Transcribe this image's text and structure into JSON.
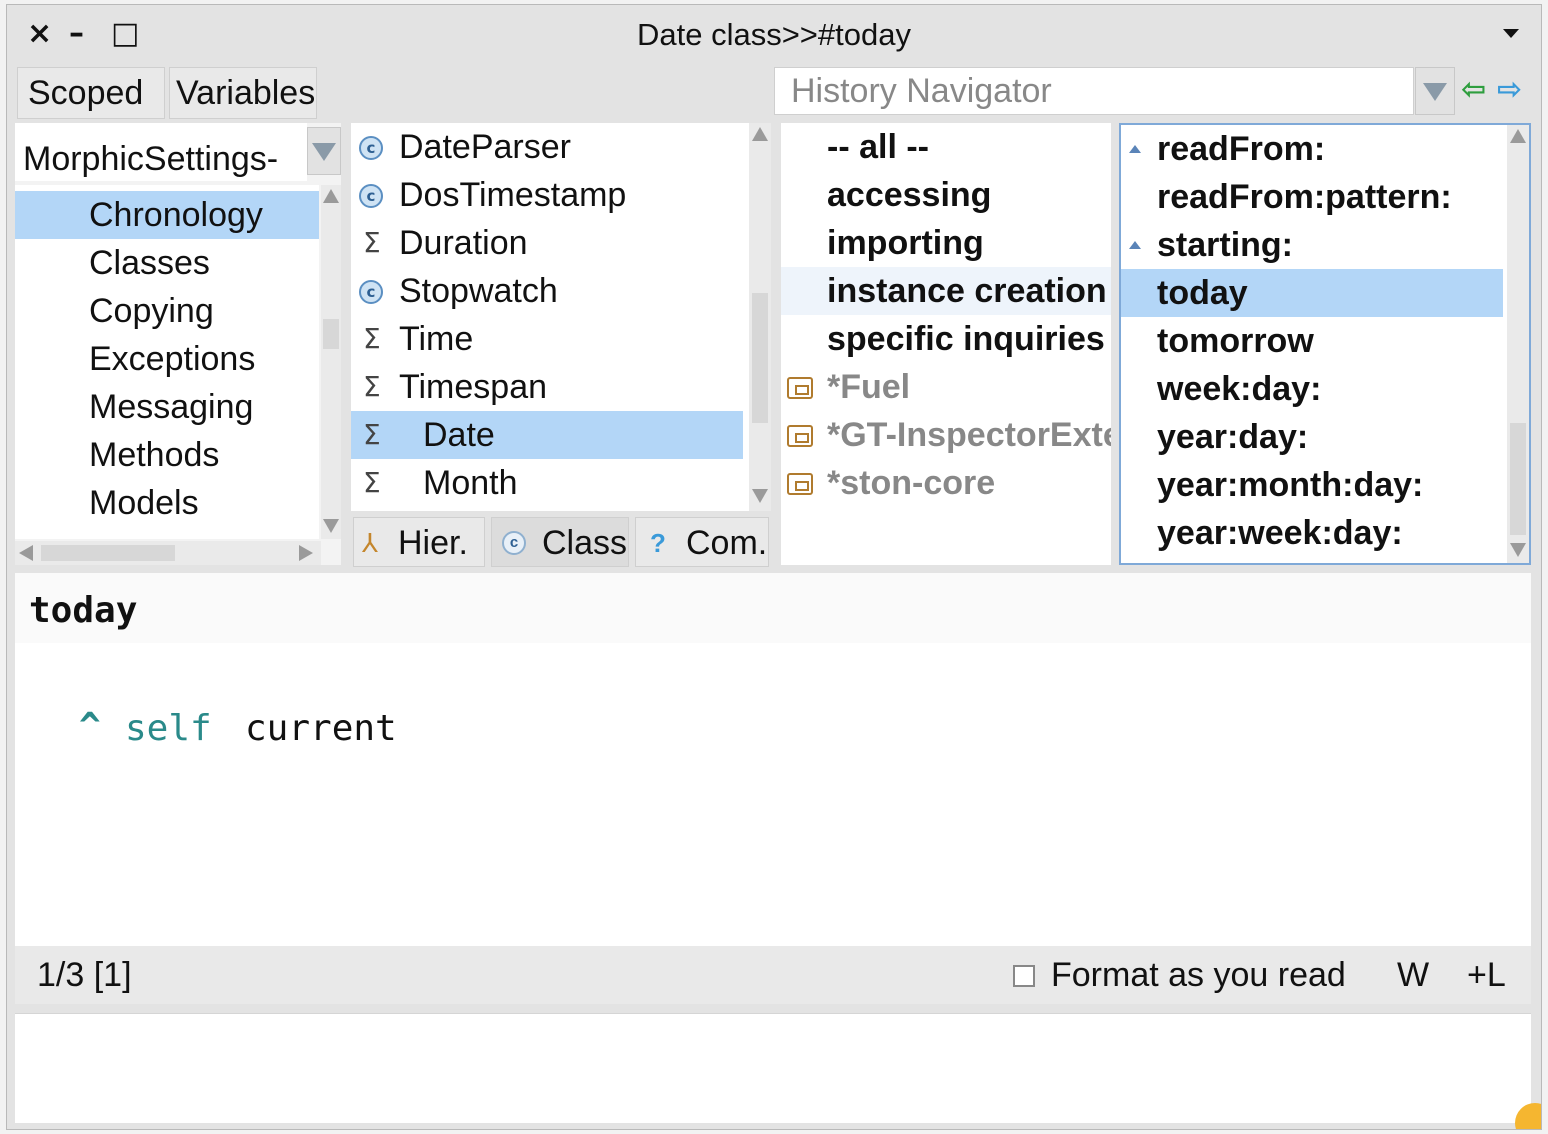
{
  "window": {
    "title": "Date class>>#today",
    "close": "×",
    "minimize": "–",
    "maximize": "□"
  },
  "toolbar": {
    "scoped": "Scoped",
    "variables": "Variables",
    "history_placeholder": "History Navigator",
    "back_arrow": "⇦",
    "forward_arrow": "⇨"
  },
  "packages": {
    "dropdown_value": "MorphicSettings-",
    "items": [
      "Chronology",
      "Classes",
      "Copying",
      "Exceptions",
      "Messaging",
      "Methods",
      "Models"
    ],
    "selected": "Chronology"
  },
  "classes": {
    "items": [
      {
        "name": "DateParser",
        "icon": "class-icon"
      },
      {
        "name": "DosTimestamp",
        "icon": "class-icon"
      },
      {
        "name": "Duration",
        "icon": "sigma-icon"
      },
      {
        "name": "Stopwatch",
        "icon": "class-icon"
      },
      {
        "name": "Time",
        "icon": "sigma-icon"
      },
      {
        "name": "Timespan",
        "icon": "sigma-icon"
      },
      {
        "name": "Date",
        "icon": "sigma-icon"
      },
      {
        "name": "Month",
        "icon": "sigma-icon"
      }
    ],
    "selected": "Date",
    "tabs": {
      "hier": "Hier.",
      "class": "Class",
      "com": "Com."
    }
  },
  "protocols": {
    "items": [
      "-- all --",
      "accessing",
      "importing",
      "instance creation",
      "specific inquiries"
    ],
    "extensions": [
      "*Fuel",
      "*GT-InspectorExte",
      "*ston-core"
    ]
  },
  "methods": {
    "items": [
      "readFrom:",
      "readFrom:pattern:",
      "starting:",
      "today",
      "tomorrow",
      "week:day:",
      "year:day:",
      "year:month:day:",
      "year:week:day:"
    ],
    "selected": "today"
  },
  "editor": {
    "selector": "today",
    "caret": "^",
    "keyword": "self",
    "message": "current"
  },
  "status": {
    "position": "1/3 [1]",
    "format_label": "Format as you read",
    "wrap": "W",
    "line": "+L"
  },
  "colors": {
    "selection": "#b3d6f7",
    "keyword": "#2a8a8a"
  }
}
